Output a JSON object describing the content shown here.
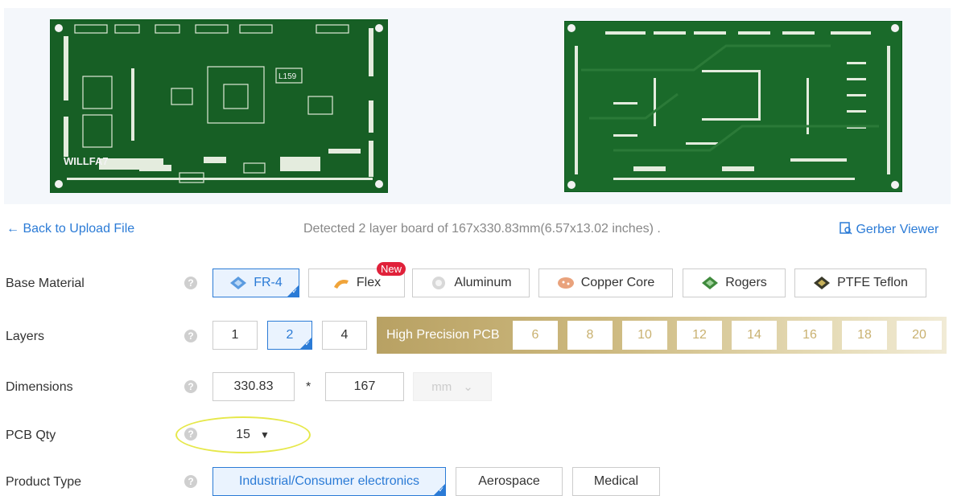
{
  "preview": {
    "top_board": {
      "silk_text": "WILLFA7",
      "chip_label": "L159"
    },
    "bottom_board": {}
  },
  "nav": {
    "back_label": "Back to Upload File",
    "detected_text": "Detected 2 layer board of 167x330.83mm(6.57x13.02 inches) .",
    "gerber_label": "Gerber Viewer"
  },
  "help_glyph": "?",
  "base_material": {
    "label": "Base Material",
    "options": [
      "FR-4",
      "Flex",
      "Aluminum",
      "Copper Core",
      "Rogers",
      "PTFE Teflon"
    ],
    "selected": "FR-4",
    "new_badge": "New"
  },
  "layers": {
    "label": "Layers",
    "options": [
      "1",
      "2",
      "4"
    ],
    "selected": "2",
    "high_precision_label": "High Precision PCB",
    "high_precision_options": [
      "6",
      "8",
      "10",
      "12",
      "14",
      "16",
      "18",
      "20"
    ]
  },
  "dimensions": {
    "label": "Dimensions",
    "length": "330.83",
    "separator": "*",
    "width": "167",
    "unit": "mm"
  },
  "pcb_qty": {
    "label": "PCB Qty",
    "value": "15"
  },
  "product_type": {
    "label": "Product Type",
    "options": [
      "Industrial/Consumer electronics",
      "Aerospace",
      "Medical"
    ],
    "selected": "Industrial/Consumer electronics"
  },
  "colors": {
    "accent": "#2b7bd6",
    "badge": "#e0213a",
    "gold": "#c9b170",
    "pcb_green": "#175f25"
  }
}
